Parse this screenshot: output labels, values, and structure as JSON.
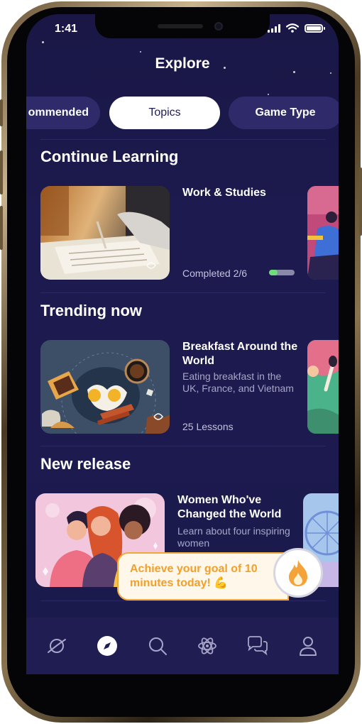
{
  "status_bar": {
    "time": "1:41"
  },
  "header": {
    "title": "Explore"
  },
  "tabs": [
    {
      "label": "Recommended",
      "display": "ommended",
      "active": false
    },
    {
      "label": "Topics",
      "active": true
    },
    {
      "label": "Game Type",
      "active": false
    }
  ],
  "sections": {
    "continue": {
      "title": "Continue Learning",
      "card": {
        "title": "Work & Studies",
        "meta": "Completed 2/6",
        "progress": 0.33
      }
    },
    "trending": {
      "title": "Trending now",
      "card": {
        "title": "Breakfast Around the World",
        "description": "Eating breakfast in the UK, France, and Vietnam",
        "meta": "25 Lessons"
      }
    },
    "new_release": {
      "title": "New release",
      "card": {
        "title": "Women Who've Changed the World",
        "description": "Learn about four inspiring women"
      }
    }
  },
  "goal_banner": {
    "text": "Achieve your goal of 10 minutes today! 💪"
  },
  "nav": [
    {
      "name": "planet-icon",
      "active": false
    },
    {
      "name": "compass-icon",
      "active": true
    },
    {
      "name": "search-icon",
      "active": false
    },
    {
      "name": "atom-icon",
      "active": false
    },
    {
      "name": "chat-icon",
      "active": false
    },
    {
      "name": "profile-icon",
      "active": false
    }
  ],
  "colors": {
    "background": "#1b1a4d",
    "accent_orange": "#f2a93b",
    "progress_green": "#6fde7a",
    "tab_inactive": "#2f2b6a"
  }
}
